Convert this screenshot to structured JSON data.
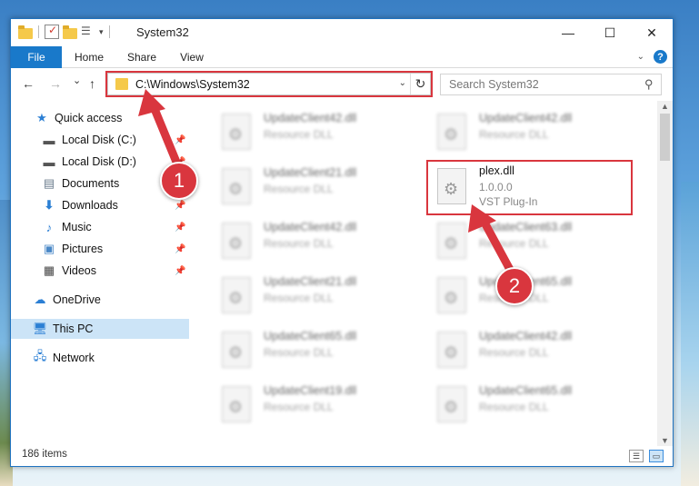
{
  "window": {
    "title": "System32",
    "minimize": "—",
    "maximize": "☐",
    "close": "✕"
  },
  "ribbon": {
    "tabs": [
      "File",
      "Home",
      "Share",
      "View"
    ],
    "help": "?"
  },
  "navigation": {
    "back": "←",
    "forward": "→",
    "recent": "⌄",
    "up": "↑",
    "address": "C:\\Windows\\System32",
    "refresh": "↻",
    "search_placeholder": "Search System32"
  },
  "sidebar": {
    "items": [
      {
        "label": "Quick access",
        "icon": "star-icon"
      },
      {
        "label": "Local Disk (C:)",
        "icon": "drive-icon",
        "pinned": true
      },
      {
        "label": "Local Disk (D:)",
        "icon": "drive-icon",
        "pinned": true
      },
      {
        "label": "Documents",
        "icon": "documents-icon",
        "pinned": true
      },
      {
        "label": "Downloads",
        "icon": "download-icon",
        "pinned": true
      },
      {
        "label": "Music",
        "icon": "music-icon",
        "pinned": true
      },
      {
        "label": "Pictures",
        "icon": "pictures-icon",
        "pinned": true
      },
      {
        "label": "Videos",
        "icon": "videos-icon",
        "pinned": true
      },
      {
        "label": "OneDrive",
        "icon": "cloud-icon"
      },
      {
        "label": "This PC",
        "icon": "computer-icon",
        "selected": true
      },
      {
        "label": "Network",
        "icon": "network-icon"
      }
    ]
  },
  "files": [
    {
      "name": "UpdateClient42.dll",
      "type": "Resource DLL"
    },
    {
      "name": "UpdateClient42.dll",
      "type": "Resource DLL"
    },
    {
      "name": "UpdateClient21.dll",
      "type": "Resource DLL"
    },
    {
      "name": "UpdateClient42.dll",
      "type": "Resource DLL"
    },
    {
      "name": "UpdateClient63.dll",
      "type": "Resource DLL"
    },
    {
      "name": "UpdateClient21.dll",
      "type": "Resource DLL"
    },
    {
      "name": "UpdateClient65.dll",
      "type": "Resource DLL"
    },
    {
      "name": "UpdateClient65.dll",
      "type": "Resource DLL"
    },
    {
      "name": "UpdateClient42.dll",
      "type": "Resource DLL"
    },
    {
      "name": "UpdateClient19.dll",
      "type": "Resource DLL"
    },
    {
      "name": "UpdateClient65.dll",
      "type": "Resource DLL"
    }
  ],
  "highlighted_file": {
    "name": "plex.dll",
    "version": "1.0.0.0",
    "description": "VST Plug-In"
  },
  "status": {
    "item_count": "186 items"
  },
  "markers": {
    "step1": "1",
    "step2": "2"
  },
  "colors": {
    "accent": "#1979ca",
    "highlight": "#d9363e"
  }
}
